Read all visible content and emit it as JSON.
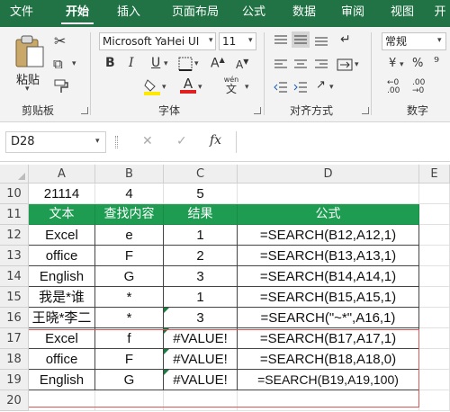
{
  "tabs": [
    "文件",
    "开始",
    "插入",
    "页面布局",
    "公式",
    "数据",
    "审阅",
    "视图",
    "开"
  ],
  "clipboard": {
    "paste_label": "粘贴",
    "group_label": "剪贴板"
  },
  "font": {
    "name": "Microsoft YaHei UI",
    "size": "11",
    "bold": "B",
    "italic": "I",
    "underline": "U",
    "font_color_letter": "A",
    "wen_label": "wén",
    "wen_char": "文",
    "group_label": "字体"
  },
  "alignment": {
    "group_label": "对齐方式"
  },
  "number": {
    "format": "常规",
    "group_label": "数字",
    "currency": "¥",
    "percent": "%"
  },
  "formula_bar": {
    "name_box": "D28",
    "cancel": "✕",
    "enter": "✓",
    "fx": "fx",
    "content": ""
  },
  "columns": [
    "A",
    "B",
    "C",
    "D",
    "E"
  ],
  "rows": [
    {
      "num": "10",
      "a": "21114",
      "b": "4",
      "c": "5",
      "d": ""
    },
    {
      "num": "11",
      "a": "文本",
      "b": "查找内容",
      "c": "结果",
      "d": "公式"
    },
    {
      "num": "12",
      "a": "Excel",
      "b": "e",
      "c": "1",
      "d": "=SEARCH(B12,A12,1)"
    },
    {
      "num": "13",
      "a": "office",
      "b": "F",
      "c": "2",
      "d": "=SEARCH(B13,A13,1)"
    },
    {
      "num": "14",
      "a": "English",
      "b": "G",
      "c": "3",
      "d": "=SEARCH(B14,A14,1)"
    },
    {
      "num": "15",
      "a": "我是*谁",
      "b": "*",
      "c": "1",
      "d": "=SEARCH(B15,A15,1)"
    },
    {
      "num": "16",
      "a": "王晓*李二",
      "b": "*",
      "c": "3",
      "d": "=SEARCH(\"~*\",A16,1)"
    },
    {
      "num": "17",
      "a": "Excel",
      "b": "f",
      "c": "#VALUE!",
      "d": "=SEARCH(B17,A17,1)"
    },
    {
      "num": "18",
      "a": "office",
      "b": "F",
      "c": "#VALUE!",
      "d": "=SEARCH(B18,A18,0)"
    },
    {
      "num": "19",
      "a": "English",
      "b": "G",
      "c": "#VALUE!",
      "d": "=SEARCH(B19,A19,100)"
    },
    {
      "num": "20",
      "a": "",
      "b": "",
      "c": "",
      "d": ""
    }
  ],
  "colors": {
    "ribbon_green": "#217346",
    "header_row_green": "#1e9d52",
    "red_box": "#e05555"
  }
}
